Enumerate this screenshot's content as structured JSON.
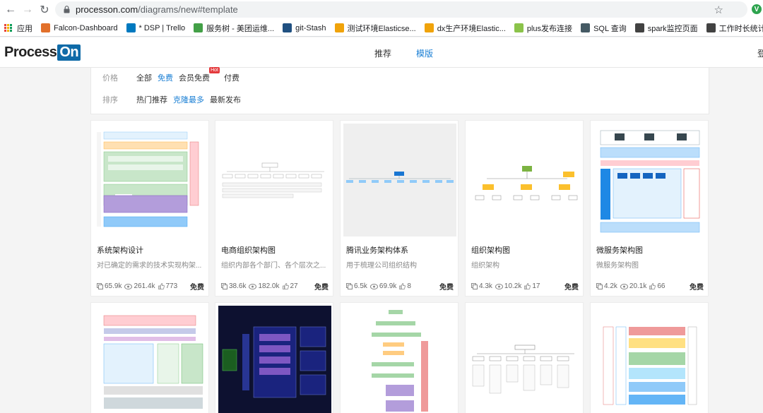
{
  "browser": {
    "url_host": "processon.com",
    "url_path": "/diagrams/new#template",
    "ext_badge": "V",
    "bookmarks": [
      {
        "label": "应用",
        "color": "#e8453c",
        "icon": "apps-grid-icon"
      },
      {
        "label": "Falcon-Dashboard",
        "color": "#e2702b",
        "icon": "chart-icon"
      },
      {
        "label": "* DSP | Trello",
        "color": "#0079bf",
        "icon": "trello-icon"
      },
      {
        "label": "服务树 - 美团运维...",
        "color": "#43a047",
        "icon": "tree-icon"
      },
      {
        "label": "git-Stash",
        "color": "#205081",
        "icon": "git-icon"
      },
      {
        "label": "测试环境Elasticse...",
        "color": "#f0a30a",
        "icon": "elastic-icon"
      },
      {
        "label": "dx生产环境Elastic...",
        "color": "#f0a30a",
        "icon": "elastic-icon"
      },
      {
        "label": "plus发布连接",
        "color": "#8bc34a",
        "icon": "plus-icon"
      },
      {
        "label": "SQL 查询",
        "color": "#455a64",
        "icon": "database-icon"
      },
      {
        "label": "spark监控页面",
        "color": "#424242",
        "icon": "globe-icon"
      },
      {
        "label": "工作时长统计",
        "color": "#424242",
        "icon": "globe-icon"
      }
    ]
  },
  "header": {
    "logo_main": "Process",
    "logo_on": "On",
    "tabs": [
      {
        "label": "推荐"
      },
      {
        "label": "模版"
      }
    ],
    "login": "登"
  },
  "filters": {
    "price_label": "价格",
    "price_options": [
      "全部",
      "免费",
      "会员免费",
      "付费"
    ],
    "hot_badge": "Hot",
    "sort_label": "排序",
    "sort_options": [
      "热门推荐",
      "克隆最多",
      "最新发布"
    ]
  },
  "cards": [
    {
      "title": "系统架构设计",
      "desc": "对已确定的需求的技术实现构架...",
      "views": "65.9k",
      "likes": "261.4k",
      "clones": "773",
      "price": "免费"
    },
    {
      "title": "电商组织架构图",
      "desc": "组织内部各个部门、各个层次之...",
      "views": "38.6k",
      "likes": "182.0k",
      "clones": "27",
      "price": "免费"
    },
    {
      "title": "腾讯业务架构体系",
      "desc": "用于梳理公司组织结构",
      "views": "6.5k",
      "likes": "69.9k",
      "clones": "8",
      "price": "免费"
    },
    {
      "title": "组织架构图",
      "desc": "组织架构",
      "views": "4.3k",
      "likes": "10.2k",
      "clones": "17",
      "price": "免费"
    },
    {
      "title": "微服务架构图",
      "desc": "微服务架构图",
      "views": "4.2k",
      "likes": "20.1k",
      "clones": "66",
      "price": "免费"
    }
  ],
  "colors": {
    "accent": "#1a7fd4",
    "hot": "#e4393c"
  }
}
